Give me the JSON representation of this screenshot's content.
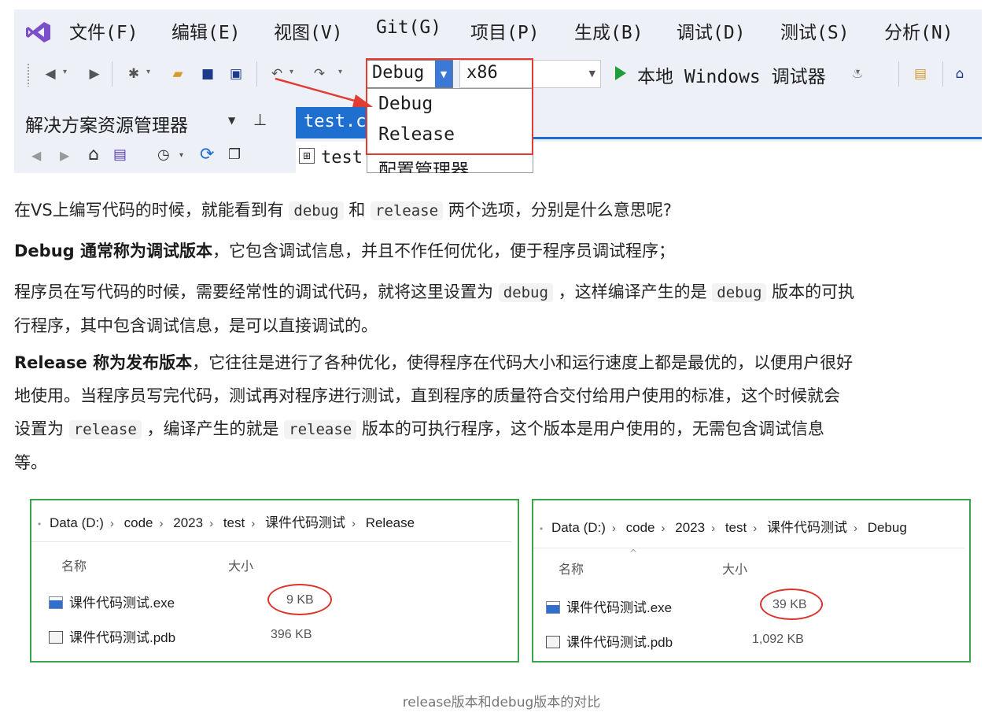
{
  "vs": {
    "menu": [
      "文件(F)",
      "编辑(E)",
      "视图(V)",
      "Git(G)",
      "项目(P)",
      "生成(B)",
      "调试(D)",
      "测试(S)",
      "分析(N)"
    ],
    "toolbar": {
      "config_value": "Debug",
      "platform_value": "x86",
      "run_label": "本地 Windows 调试器"
    },
    "config_options": [
      "Debug",
      "Release",
      "配置管理器..."
    ],
    "solution_explorer_title": "解决方案资源管理器",
    "pin_glyph": "ꟷ",
    "doc_tab": "test.c",
    "editor_file": "test",
    "accent_color": "#1f6fd0",
    "highlight_color": "#e23b34"
  },
  "article": {
    "p1": {
      "a": "在VS上编写代码的时候，就能看到有",
      "code1": "debug",
      "b": "和",
      "code2": "release",
      "c": "两个选项，分别是什么意思呢?"
    },
    "p2": {
      "bold": "Debug 通常称为调试版本",
      "rest": "，它包含调试信息，并且不作任何优化，便于程序员调试程序；"
    },
    "p3": {
      "a": "程序员在写代码的时候，需要经常性的调试代码，就将这里设置为",
      "code1": "debug",
      "b": "，这样编译产生的是",
      "code2": "debug",
      "c": "版本的可执",
      "d": "行程序，其中包含调试信息，是可以直接调试的。"
    },
    "p4": {
      "bold": "Release 称为发布版本",
      "a": "，它往往是进行了各种优化，使得程序在代码大小和运行速度上都是最优的，以便用户很好",
      "b": "地使用。当程序员写完代码，测试再对程序进行测试，直到程序的质量符合交付给用户使用的标准，这个时候就会",
      "c": "设置为",
      "code1": "release",
      "d": "，编译产生的就是",
      "code2": "release",
      "e": "版本的可执行程序，这个版本是用户使用的，无需包含调试信息",
      "f": "等。"
    }
  },
  "explorers": [
    {
      "breadcrumb": [
        "Data (D:)",
        "code",
        "2023",
        "test",
        "课件代码测试",
        "Release"
      ],
      "col_name": "名称",
      "col_size": "大小",
      "files": [
        {
          "name": "课件代码测试.exe",
          "size": "9 KB",
          "icon": "exe-icon"
        },
        {
          "name": "课件代码测试.pdb",
          "size": "396 KB",
          "icon": "pdb-icon"
        }
      ]
    },
    {
      "breadcrumb": [
        "Data (D:)",
        "code",
        "2023",
        "test",
        "课件代码测试",
        "Debug"
      ],
      "col_name": "名称",
      "col_size": "大小",
      "files": [
        {
          "name": "课件代码测试.exe",
          "size": "39 KB",
          "icon": "exe-icon"
        },
        {
          "name": "课件代码测试.pdb",
          "size": "1,092 KB",
          "icon": "pdb-icon"
        }
      ]
    }
  ],
  "caption": "release版本和debug版本的对比"
}
